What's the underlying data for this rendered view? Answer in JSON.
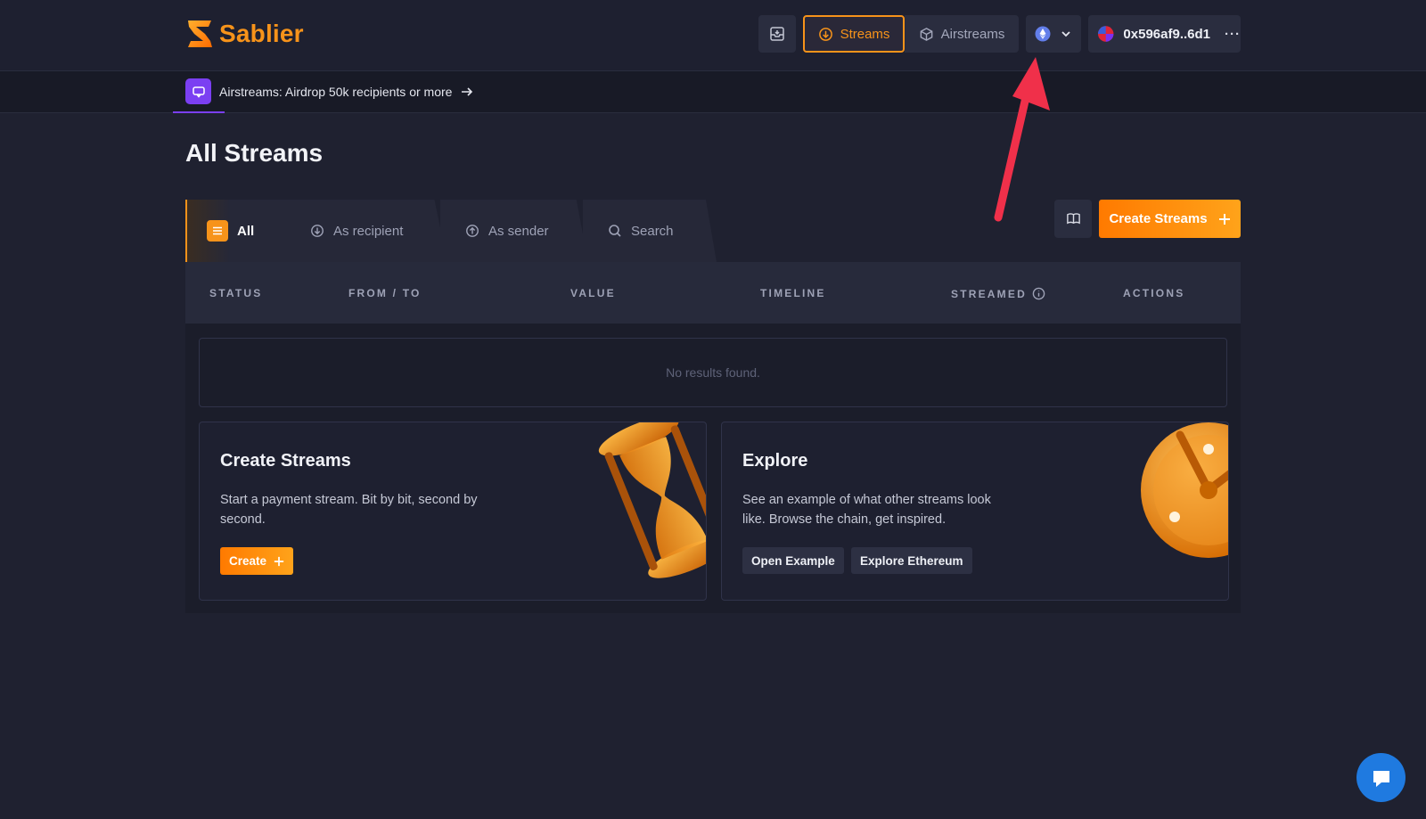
{
  "brand": {
    "name": "Sablier",
    "color": "#f7931a"
  },
  "nav": {
    "inbox_icon": "inbox-icon",
    "streams_label": "Streams",
    "airstreams_label": "Airstreams",
    "chain_icon": "ethereum-icon",
    "wallet_address": "0x596af9..6d1"
  },
  "banner": {
    "text": "Airstreams: Airdrop 50k recipients or more",
    "accent": "#7b3ff2"
  },
  "page": {
    "title": "All Streams"
  },
  "filters": {
    "tabs": [
      {
        "label": "All",
        "icon": "list-icon",
        "active": true
      },
      {
        "label": "As recipient",
        "icon": "arrow-down-circle-icon",
        "active": false
      },
      {
        "label": "As sender",
        "icon": "arrow-up-circle-icon",
        "active": false
      },
      {
        "label": "Search",
        "icon": "search-icon",
        "active": false
      }
    ]
  },
  "actions": {
    "create_streams_label": "Create Streams"
  },
  "table": {
    "columns": [
      "STATUS",
      "FROM / TO",
      "VALUE",
      "TIMELINE",
      "STREAMED",
      "ACTIONS"
    ],
    "empty_text": "No results found."
  },
  "cards": {
    "create": {
      "title": "Create Streams",
      "description": "Start a payment stream. Bit by bit, second by second.",
      "button": "Create"
    },
    "explore": {
      "title": "Explore",
      "description": "See an example of what other streams look like. Browse the chain, get inspired.",
      "button_example": "Open Example",
      "button_ethereum": "Explore Ethereum"
    }
  },
  "colors": {
    "accent": "#f7931a",
    "background": "#1f2130",
    "chat": "#1f7ae0",
    "annotation_arrow": "#f0304a"
  }
}
